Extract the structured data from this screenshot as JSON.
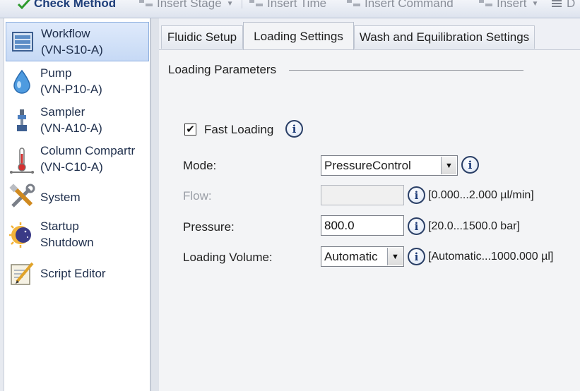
{
  "toolbar": {
    "check_method": "Check Method",
    "insert_stage": "Insert Stage",
    "insert_time": "Insert Time",
    "insert_command": "Insert Command",
    "insert": "Insert",
    "cut_off": "D"
  },
  "nav": {
    "items": [
      {
        "line1": "Workflow",
        "line2": "(VN-S10-A)",
        "icon": "workflow-icon"
      },
      {
        "line1": "Pump",
        "line2": "(VN-P10-A)",
        "icon": "pump-drop-icon"
      },
      {
        "line1": "Sampler",
        "line2": "(VN-A10-A)",
        "icon": "sampler-icon"
      },
      {
        "line1": "Column Compartr",
        "line2": "(VN-C10-A)",
        "icon": "thermometer-icon"
      },
      {
        "line1": "System",
        "icon": "tools-icon"
      },
      {
        "line1": "Startup",
        "line2": "Shutdown",
        "icon": "sun-moon-icon"
      },
      {
        "line1": "Script Editor",
        "icon": "script-editor-icon"
      }
    ]
  },
  "tabs": [
    "Fluidic Setup",
    "Loading Settings",
    "Wash and Equilibration Settings"
  ],
  "active_tab": "Loading Settings",
  "group_title": "Loading Parameters",
  "fast_loading": {
    "label": "Fast Loading",
    "checked": "✔"
  },
  "mode": {
    "label": "Mode:",
    "value": "PressureControl"
  },
  "flow": {
    "label": "Flow:",
    "value": "",
    "range": "[0.000...2.000 µl/min]"
  },
  "pressure": {
    "label": "Pressure:",
    "value": "800.0",
    "range": "[20.0...1500.0 bar]"
  },
  "loading_volume": {
    "label": "Loading Volume:",
    "value": "Automatic",
    "range": "[Automatic...1000.000 µl]"
  },
  "colors": {
    "accent": "#1f3f7a",
    "selected_bg": "#c6d9f5",
    "panel_bg": "#f3f4f6"
  }
}
